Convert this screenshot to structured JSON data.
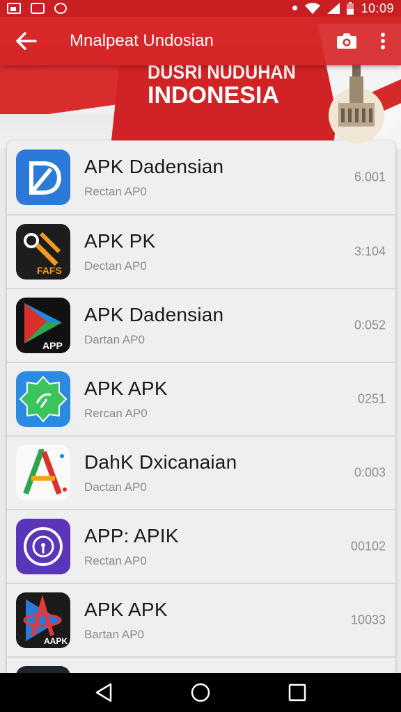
{
  "status_bar": {
    "time": "10:09",
    "left_icons": [
      "image-icon",
      "message-icon",
      "cat-icon"
    ],
    "right_icons": [
      "vibrate-icon",
      "wifi-icon",
      "signal-icon",
      "battery-icon"
    ]
  },
  "toolbar": {
    "title": "Mnalpeat Undosian",
    "back_icon": "arrow-left-icon",
    "camera_icon": "camera-icon",
    "more_icon": "more-vert-icon"
  },
  "banner": {
    "line1": "DUSRI NUDUHAN",
    "line2": "INDONESIA"
  },
  "apps": [
    {
      "name": "APK Dadensian",
      "subtitle": "Rectan AP0",
      "value": "6.001",
      "icon": "blue-d-logo-icon"
    },
    {
      "name": "APK PK",
      "subtitle": "Dectan AP0",
      "value": "3:104",
      "icon": "fafs-key-icon"
    },
    {
      "name": "APK Dadensian",
      "subtitle": "Dartan AP0",
      "value": "0:052",
      "icon": "play-app-icon"
    },
    {
      "name": "APK APK",
      "subtitle": "Rercan AP0",
      "value": "0251",
      "icon": "green-badge-icon"
    },
    {
      "name": "DahK Dxicanaian",
      "subtitle": "Dactan AP0",
      "value": "0:003",
      "icon": "letter-a-icon"
    },
    {
      "name": "APP: APIK",
      "subtitle": "Rectan AP0",
      "value": "00102",
      "icon": "purple-ring-icon"
    },
    {
      "name": "APK APK",
      "subtitle": "Bartan AP0",
      "value": "10033",
      "icon": "aapk-logo-icon"
    }
  ],
  "nav": {
    "back_icon": "nav-back-icon",
    "home_icon": "nav-home-icon",
    "recents_icon": "nav-recents-icon"
  },
  "colors": {
    "accent_red": "#d82a2b",
    "status_bar": "#c91f22",
    "list_bg": "#efefef"
  }
}
